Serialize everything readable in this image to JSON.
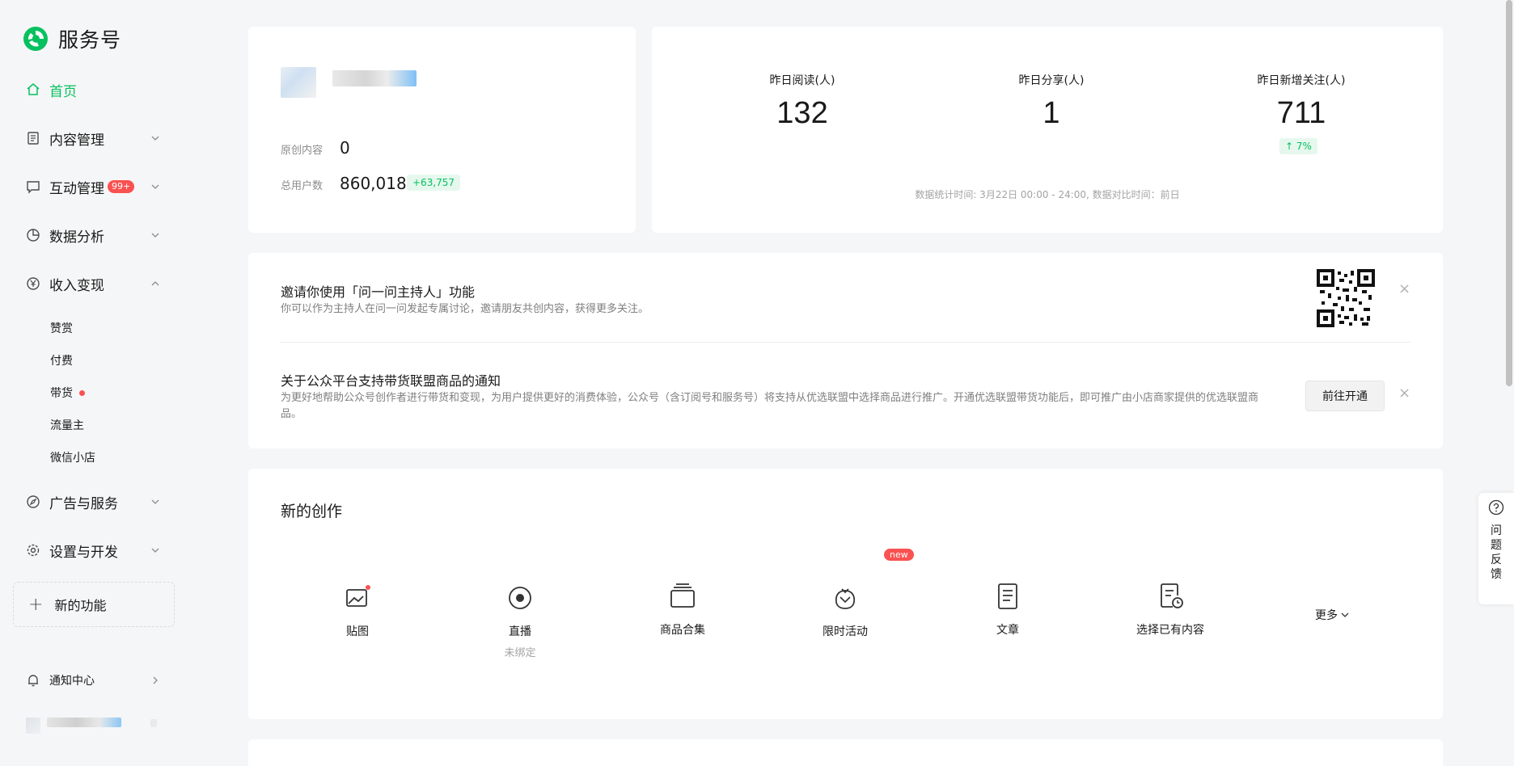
{
  "app": {
    "name": "服务号"
  },
  "sidebar": {
    "home": "首页",
    "items": [
      {
        "label": "内容管理"
      },
      {
        "label": "互动管理",
        "badge": "99+"
      },
      {
        "label": "数据分析"
      },
      {
        "label": "收入变现"
      },
      {
        "label": "广告与服务"
      },
      {
        "label": "设置与开发"
      }
    ],
    "sub_items": [
      {
        "label": "赞赏"
      },
      {
        "label": "付费"
      },
      {
        "label": "带货"
      },
      {
        "label": "流量主"
      },
      {
        "label": "微信小店"
      }
    ],
    "new_feature": "新的功能",
    "notification_center": "通知中心"
  },
  "profile": {
    "original_label": "原创内容",
    "original_value": "0",
    "users_label": "总用户数",
    "users_value": "860,018",
    "users_delta": "+63,757"
  },
  "stats": {
    "items": [
      {
        "label": "昨日阅读(人)",
        "value": "132"
      },
      {
        "label": "昨日分享(人)",
        "value": "1"
      },
      {
        "label": "昨日新增关注(人)",
        "value": "711",
        "change": "↑ 7%"
      }
    ],
    "note": "数据统计时间: 3月22日 00:00 - 24:00, 数据对比时间：前日"
  },
  "notices": [
    {
      "title": "邀请你使用「问一问主持人」功能",
      "desc": "你可以作为主持人在问一问发起专属讨论，邀请朋友共创内容，获得更多关注。"
    },
    {
      "title": "关于公众平台支持带货联盟商品的通知",
      "desc": "为更好地帮助公众号创作者进行带货和变现，为用户提供更好的消费体验，公众号（含订阅号和服务号）将支持从优选联盟中选择商品进行推广。开通优选联盟带货功能后，即可推广由小店商家提供的优选联盟商品。",
      "button": "前往开通"
    }
  ],
  "create": {
    "title": "新的创作",
    "items": [
      {
        "label": "贴图",
        "icon": "image-icon"
      },
      {
        "label": "直播",
        "sub": "未绑定",
        "icon": "live-icon"
      },
      {
        "label": "商品合集",
        "icon": "collection-icon"
      },
      {
        "label": "限时活动",
        "icon": "activity-icon",
        "tag": "new"
      },
      {
        "label": "文章",
        "icon": "article-icon"
      },
      {
        "label": "选择已有内容",
        "icon": "existing-content-icon"
      }
    ],
    "more": "更多"
  },
  "feedback": {
    "label": "问题反馈"
  },
  "colors": {
    "brand": "#07c160",
    "alert": "#fa5151"
  }
}
